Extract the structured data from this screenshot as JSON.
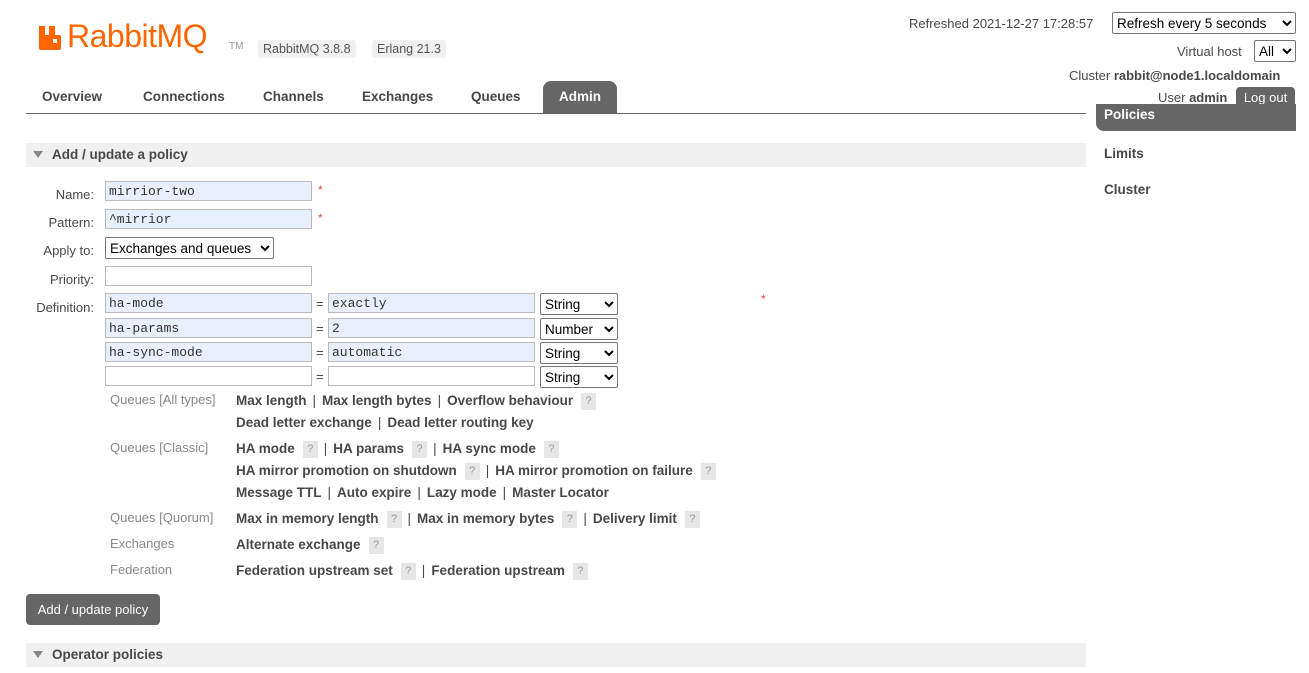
{
  "header": {
    "logo_text": "RabbitMQ",
    "logo_tm": "TM",
    "rabbitmq_version": "RabbitMQ 3.8.8",
    "erlang_version": "Erlang 21.3",
    "refreshed_label": "Refreshed 2021-12-27 17:28:57",
    "refresh_select": "Refresh every 5 seconds",
    "virtual_host_label": "Virtual host",
    "virtual_host_select": "All",
    "cluster_label": "Cluster",
    "cluster_name": "rabbit@node1.localdomain",
    "user_label": "User",
    "user_name": "admin",
    "logout_label": "Log out",
    "brand_color": "#ff6600"
  },
  "nav": {
    "tabs": [
      "Overview",
      "Connections",
      "Channels",
      "Exchanges",
      "Queues",
      "Admin"
    ],
    "active": "Admin"
  },
  "sidebar": {
    "items": [
      "Policies",
      "Limits",
      "Cluster"
    ],
    "active": "Policies"
  },
  "section_add": {
    "title": "Add / update a policy",
    "name_label": "Name:",
    "name_value": "mirrior-two",
    "pattern_label": "Pattern:",
    "pattern_value": "^mirrior",
    "apply_label": "Apply to:",
    "apply_value": "Exchanges and queues",
    "priority_label": "Priority:",
    "priority_value": "",
    "definition_label": "Definition:",
    "required_mark": "*",
    "equals": "=",
    "definitions": [
      {
        "key": "ha-mode",
        "value": "exactly",
        "type": "String"
      },
      {
        "key": "ha-params",
        "value": "2",
        "type": "Number"
      },
      {
        "key": "ha-sync-mode",
        "value": "automatic",
        "type": "String"
      },
      {
        "key": "",
        "value": "",
        "type": "String"
      }
    ],
    "help_groups": {
      "queues_all": {
        "label": "Queues [All types]",
        "row1": [
          "Max length",
          "Max length bytes",
          "Overflow behaviour"
        ],
        "row2": [
          "Dead letter exchange",
          "Dead letter routing key"
        ]
      },
      "queues_classic": {
        "label": "Queues [Classic]",
        "row1": [
          "HA mode",
          "HA params",
          "HA sync mode"
        ],
        "row2": [
          "HA mirror promotion on shutdown",
          "HA mirror promotion on failure"
        ],
        "row3": [
          "Message TTL",
          "Auto expire",
          "Lazy mode",
          "Master Locator"
        ]
      },
      "queues_quorum": {
        "label": "Queues [Quorum]",
        "row1": [
          "Max in memory length",
          "Max in memory bytes",
          "Delivery limit"
        ]
      },
      "exchanges": {
        "label": "Exchanges",
        "row1": [
          "Alternate exchange"
        ]
      },
      "federation": {
        "label": "Federation",
        "row1": [
          "Federation upstream set",
          "Federation upstream"
        ]
      }
    },
    "help_mark": "?",
    "separator": "|",
    "submit_label": "Add / update policy"
  },
  "section_operator": {
    "title": "Operator policies"
  }
}
